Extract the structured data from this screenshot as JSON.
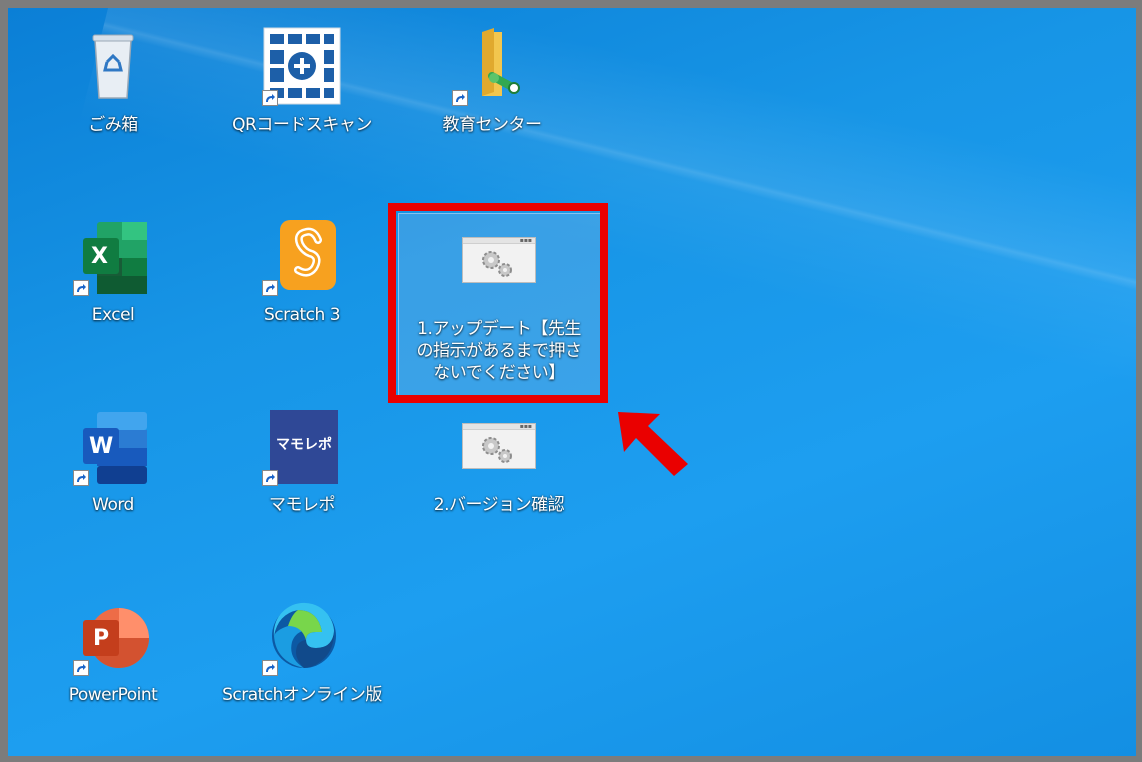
{
  "desktop": {
    "icons": [
      {
        "key": "recycle_bin",
        "label": "ごみ箱"
      },
      {
        "key": "qr_scan",
        "label": "QRコードスキャン"
      },
      {
        "key": "education_center",
        "label": "教育センター"
      },
      {
        "key": "excel",
        "label": "Excel"
      },
      {
        "key": "scratch3",
        "label": "Scratch 3"
      },
      {
        "key": "update",
        "label": "1.アップデート【先生の指示があるまで押さないでください】"
      },
      {
        "key": "word",
        "label": "Word"
      },
      {
        "key": "mamorepo",
        "label": "マモレポ",
        "tile_text": "マモレポ"
      },
      {
        "key": "version_check",
        "label": "2.バージョン確認"
      },
      {
        "key": "powerpoint",
        "label": "PowerPoint"
      },
      {
        "key": "scratch_online",
        "label": "Scratchオンライン版"
      }
    ],
    "icon_glyphs": {
      "excel": "X",
      "word": "W",
      "powerpoint": "P"
    }
  },
  "annotation": {
    "highlight_color": "#ea0000",
    "arrow_color": "#ea0000"
  }
}
